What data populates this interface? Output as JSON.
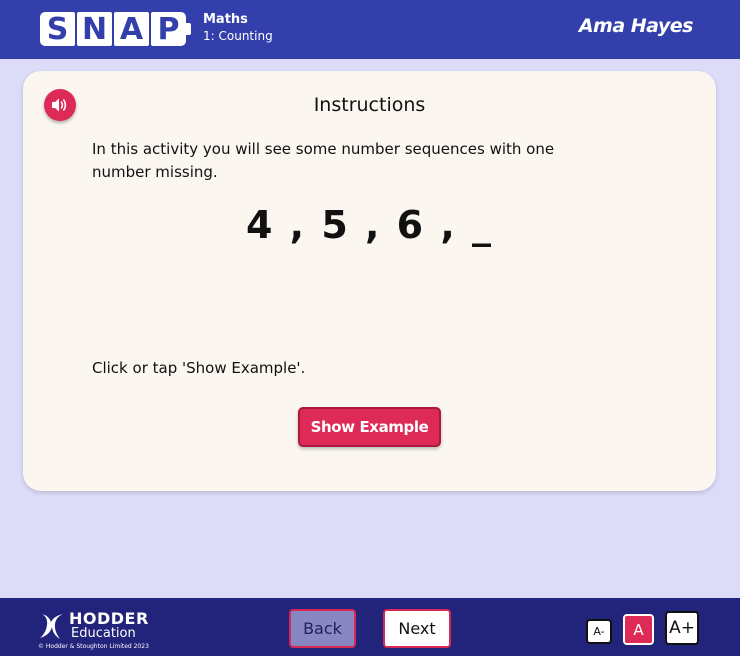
{
  "header": {
    "logo_letters": [
      "S",
      "N",
      "A",
      "P"
    ],
    "subject": "Maths",
    "unit": "1: Counting",
    "user_name": "Ama Hayes"
  },
  "card": {
    "title": "Instructions",
    "instruction_text": "In this activity you will see some number sequences with one number missing.",
    "sequence": "4 , 5 , 6 , _",
    "prompt": "Click or tap 'Show Example'.",
    "show_example_label": "Show Example",
    "audio_icon": "speaker-icon"
  },
  "footer": {
    "brand_line1": "HODDER",
    "brand_line2": "Education",
    "copyright": "© Hodder & Stoughton Limited 2023",
    "back_label": "Back",
    "next_label": "Next",
    "font_smaller_label": "A-",
    "font_normal_label": "A",
    "font_larger_label": "A+"
  },
  "colors": {
    "header_blue": "#3340ab",
    "footer_navy": "#22237a",
    "accent_red": "#dd2a57",
    "background": "#dcdcf9",
    "card": "#fcf6f1"
  }
}
